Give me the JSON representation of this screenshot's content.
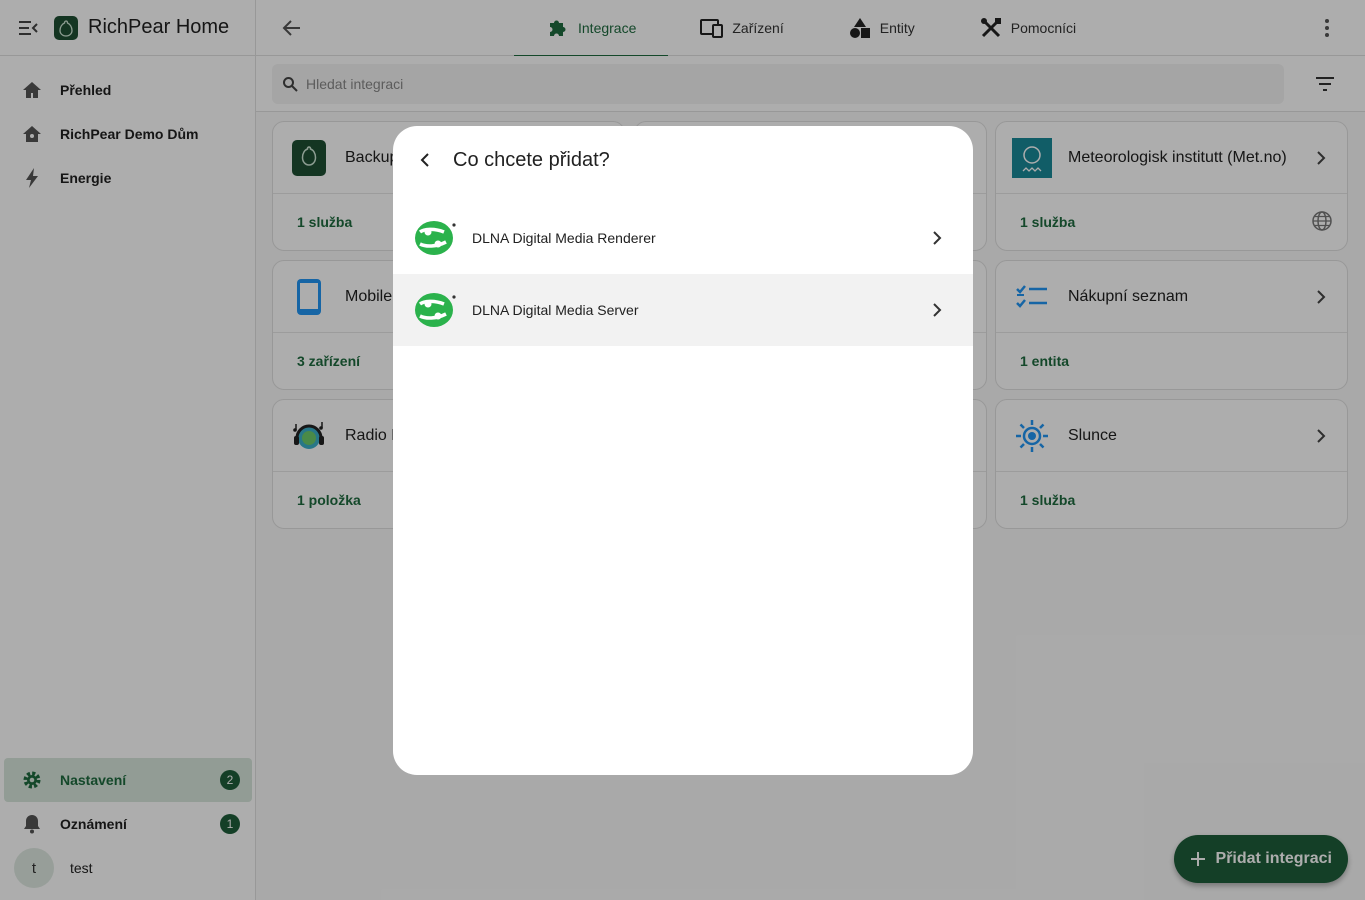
{
  "app": {
    "title": "RichPear Home"
  },
  "sidebar": {
    "items": [
      {
        "label": "Přehled",
        "icon": "home-icon"
      },
      {
        "label": "RichPear Demo Dům",
        "icon": "house-icon"
      },
      {
        "label": "Energie",
        "icon": "lightning-icon"
      }
    ],
    "bottom": [
      {
        "label": "Nastavení",
        "icon": "gear-icon",
        "badge": "2"
      },
      {
        "label": "Oznámení",
        "icon": "bell-icon",
        "badge": "1"
      }
    ],
    "user": {
      "initial": "t",
      "name": "test"
    }
  },
  "tabs": [
    {
      "label": "Integrace",
      "icon": "puzzle-icon"
    },
    {
      "label": "Zařízení",
      "icon": "devices-icon"
    },
    {
      "label": "Entity",
      "icon": "shapes-icon"
    },
    {
      "label": "Pomocníci",
      "icon": "tools-icon"
    }
  ],
  "search": {
    "placeholder": "Hledat integraci"
  },
  "cards": [
    {
      "name": "Backup",
      "footer": "1 služba"
    },
    {
      "name": "Meteorologisk institutt (Met.no)",
      "footer": "1 služba"
    },
    {
      "name": "Mobile",
      "footer": "3 zařízení"
    },
    {
      "name": "Nákupní seznam",
      "footer": "1 entita"
    },
    {
      "name": "Radio Browser",
      "footer": "1 položka"
    },
    {
      "name": "Slunce",
      "footer": "1 služba"
    }
  ],
  "fab": {
    "label": "Přidat integraci"
  },
  "dialog": {
    "title": "Co chcete přidat?",
    "items": [
      {
        "label": "DLNA Digital Media Renderer"
      },
      {
        "label": "DLNA Digital Media Server"
      }
    ]
  },
  "colors": {
    "accent": "#1e6a3e",
    "fab": "#1e5e3a",
    "dlna_green": "#2bb24c"
  }
}
